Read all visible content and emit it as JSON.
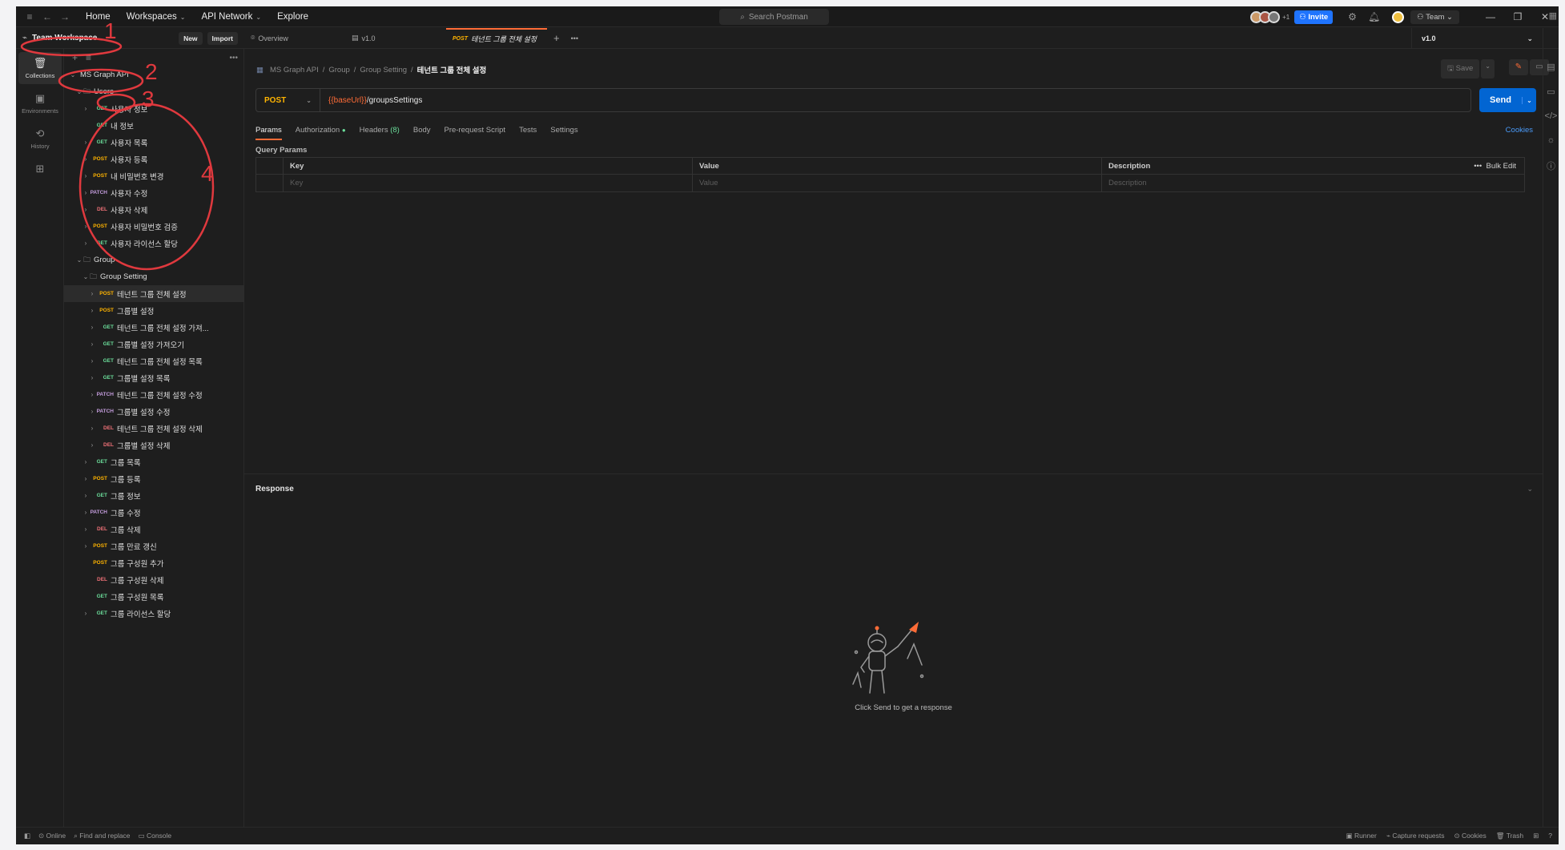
{
  "titlebar": {
    "nav": [
      {
        "label": "Home",
        "dropdown": false
      },
      {
        "label": "Workspaces",
        "dropdown": true
      },
      {
        "label": "API Network",
        "dropdown": true
      },
      {
        "label": "Explore",
        "dropdown": false
      }
    ],
    "search_placeholder": "Search Postman",
    "avatar_extra_count": "+1",
    "invite_label": "Invite",
    "team_label": "Team"
  },
  "workspace": {
    "name": "Team Workspace",
    "new_label": "New",
    "import_label": "Import"
  },
  "sidebar_nav": [
    {
      "label": "Collections",
      "icon": "collections-icon",
      "active": true
    },
    {
      "label": "Environments",
      "icon": "environments-icon",
      "active": false
    },
    {
      "label": "History",
      "icon": "history-icon",
      "active": false
    },
    {
      "label": "",
      "icon": "add-apps-icon",
      "active": false
    }
  ],
  "tree": [
    {
      "depth": 0,
      "caret": "v",
      "type": "collection",
      "label": "MS Graph API"
    },
    {
      "depth": 1,
      "caret": "v",
      "type": "folder",
      "label": "Users"
    },
    {
      "depth": 2,
      "caret": ">",
      "method": "GET",
      "label": "사용자 정보"
    },
    {
      "depth": 2,
      "caret": "",
      "method": "GET",
      "label": "내 정보"
    },
    {
      "depth": 2,
      "caret": ">",
      "method": "GET",
      "label": "사용자 목록"
    },
    {
      "depth": 2,
      "caret": ">",
      "method": "POST",
      "label": "사용자 등록"
    },
    {
      "depth": 2,
      "caret": ">",
      "method": "POST",
      "label": "내 비밀번호 변경"
    },
    {
      "depth": 2,
      "caret": ">",
      "method": "PATCH",
      "label": "사용자 수정"
    },
    {
      "depth": 2,
      "caret": ">",
      "method": "DEL",
      "label": "사용자 삭제"
    },
    {
      "depth": 2,
      "caret": ">",
      "method": "POST",
      "label": "사용자 비밀번호 검증"
    },
    {
      "depth": 2,
      "caret": ">",
      "method": "GET",
      "label": "사용자 라이선스 할당"
    },
    {
      "depth": 1,
      "caret": "v",
      "type": "folder",
      "label": "Group"
    },
    {
      "depth": 2,
      "caret": "v",
      "type": "folder",
      "label": "Group Setting"
    },
    {
      "depth": 3,
      "caret": ">",
      "method": "POST",
      "label": "테넌트 그룹 전체 설정",
      "selected": true
    },
    {
      "depth": 3,
      "caret": ">",
      "method": "POST",
      "label": "그룹별 설정"
    },
    {
      "depth": 3,
      "caret": ">",
      "method": "GET",
      "label": "테넌트 그룹 전체 설정 가져..."
    },
    {
      "depth": 3,
      "caret": ">",
      "method": "GET",
      "label": "그룹별 설정 가져오기"
    },
    {
      "depth": 3,
      "caret": ">",
      "method": "GET",
      "label": "테넌트 그룹 전체 설정 목록"
    },
    {
      "depth": 3,
      "caret": ">",
      "method": "GET",
      "label": "그룹별 설정 목록"
    },
    {
      "depth": 3,
      "caret": ">",
      "method": "PATCH",
      "label": "테넌트 그룹 전체 설정 수정"
    },
    {
      "depth": 3,
      "caret": ">",
      "method": "PATCH",
      "label": "그룹별 설정 수정"
    },
    {
      "depth": 3,
      "caret": ">",
      "method": "DEL",
      "label": "테넌트 그룹 전체 설정 삭제"
    },
    {
      "depth": 3,
      "caret": ">",
      "method": "DEL",
      "label": "그룹별 설정 삭제"
    },
    {
      "depth": 2,
      "caret": ">",
      "method": "GET",
      "label": "그룹 목록"
    },
    {
      "depth": 2,
      "caret": ">",
      "method": "POST",
      "label": "그룹 등록"
    },
    {
      "depth": 2,
      "caret": ">",
      "method": "GET",
      "label": "그룹 정보"
    },
    {
      "depth": 2,
      "caret": ">",
      "method": "PATCH",
      "label": "그룹 수정"
    },
    {
      "depth": 2,
      "caret": ">",
      "method": "DEL",
      "label": "그룹 삭제"
    },
    {
      "depth": 2,
      "caret": ">",
      "method": "POST",
      "label": "그룹 만료 갱신"
    },
    {
      "depth": 2,
      "caret": "",
      "method": "POST",
      "label": "그룹 구성원 추가"
    },
    {
      "depth": 2,
      "caret": "",
      "method": "DEL",
      "label": "그룹 구성원 삭제"
    },
    {
      "depth": 2,
      "caret": "",
      "method": "GET",
      "label": "그룹 구성원 목록"
    },
    {
      "depth": 2,
      "caret": ">",
      "method": "GET",
      "label": "그룹 라이선스 할당"
    }
  ],
  "tabs": {
    "overview": "Overview",
    "version": "v1.0",
    "active_method": "POST",
    "active_label": "테넌트 그룹 전체 설정"
  },
  "environment": "v1.0",
  "breadcrumb": {
    "parts": [
      "MS Graph API",
      "Group",
      "Group Setting"
    ],
    "current": "테넌트 그룹 전체 설정"
  },
  "save_label": "Save",
  "request": {
    "method": "POST",
    "url_var": "{{baseUrl}}",
    "url_path": "/groupsSettings",
    "send_label": "Send"
  },
  "req_tabs": {
    "params": "Params",
    "authorization": "Authorization",
    "headers": "Headers",
    "headers_count": "(8)",
    "body": "Body",
    "prerequest": "Pre-request Script",
    "tests": "Tests",
    "settings": "Settings",
    "cookies": "Cookies"
  },
  "query_params": {
    "title": "Query Params",
    "headers": {
      "key": "Key",
      "value": "Value",
      "description": "Description",
      "bulk": "Bulk Edit"
    },
    "placeholders": {
      "key": "Key",
      "value": "Value",
      "description": "Description"
    }
  },
  "response": {
    "title": "Response",
    "empty_message": "Click Send to get a response"
  },
  "statusbar": {
    "online": "Online",
    "find_replace": "Find and replace",
    "console": "Console",
    "runner": "Runner",
    "capture": "Capture requests",
    "cookies": "Cookies",
    "trash": "Trash"
  },
  "annotations": {
    "n1": "1",
    "n2": "2",
    "n3": "3",
    "n4": "4",
    "color": "#e0393e"
  },
  "colors": {
    "accent": "#ff6c37",
    "send": "#0265d2",
    "invite": "#1f74ff",
    "get": "#6bdd9a",
    "post": "#ffb400",
    "patch": "#c39cdc",
    "del": "#f07178"
  }
}
